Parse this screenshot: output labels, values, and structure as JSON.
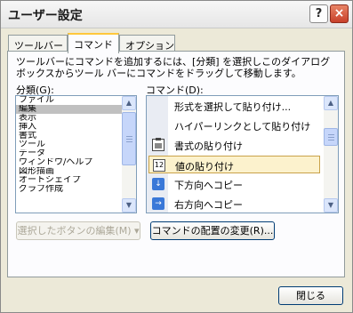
{
  "window": {
    "title": "ユーザー設定",
    "help_glyph": "?",
    "close_glyph": "×"
  },
  "tabs": [
    {
      "label": "ツールバー",
      "active": false
    },
    {
      "label": "コマンド",
      "active": true
    },
    {
      "label": "オプション",
      "active": false
    }
  ],
  "instruction": "ツールバーにコマンドを追加するには、[分類] を選択しこのダイアログ ボックスからツール バーにコマンドをドラッグして移動します。",
  "categories": {
    "label": "分類(G):",
    "items": [
      "ファイル",
      "編集",
      "表示",
      "挿入",
      "書式",
      "ツール",
      "データ",
      "ウィンドウ/ヘルプ",
      "図形描画",
      "オートシェイプ",
      "グラフ作成"
    ],
    "selected": "編集"
  },
  "commands": {
    "label": "コマンド(D):",
    "items": [
      {
        "label": "形式を選択して貼り付け...",
        "icon": "none"
      },
      {
        "label": "ハイパーリンクとして貼り付け",
        "icon": "none"
      },
      {
        "label": "書式の貼り付け",
        "icon": "paste-format-icon"
      },
      {
        "label": "値の貼り付け",
        "icon": "paste-values-icon",
        "selected": true
      },
      {
        "label": "下方向へコピー",
        "icon": "fill-down-icon"
      },
      {
        "label": "右方向へコピー",
        "icon": "fill-right-icon"
      }
    ]
  },
  "buttons": {
    "modify_selection": "選択したボタンの編集(M) ▾",
    "rearrange": "コマンドの配置の変更(R)...",
    "close": "閉じる"
  }
}
